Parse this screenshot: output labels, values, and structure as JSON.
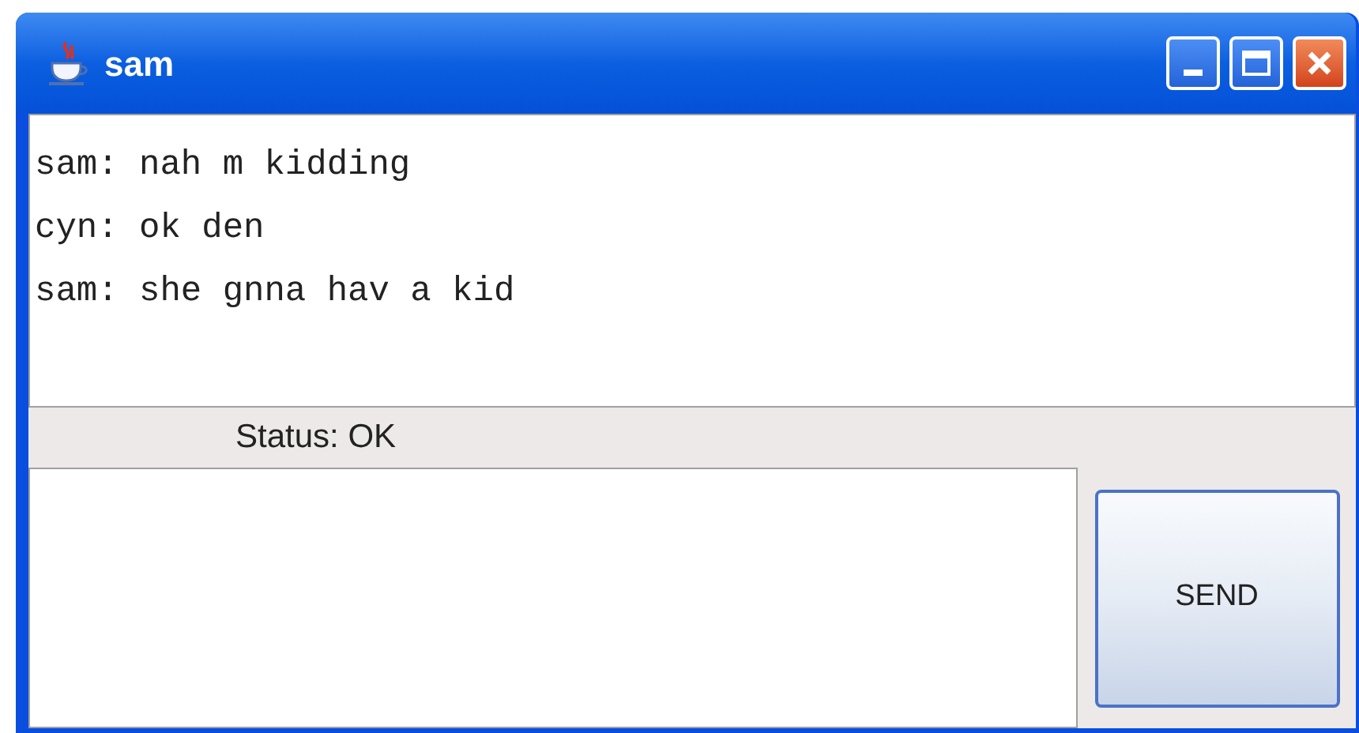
{
  "window": {
    "title": "sam"
  },
  "messages": [
    "sam: nah m kidding",
    "cyn: ok den",
    "sam: she gnna hav a kid"
  ],
  "status": "Status: OK",
  "send_button": "SEND"
}
